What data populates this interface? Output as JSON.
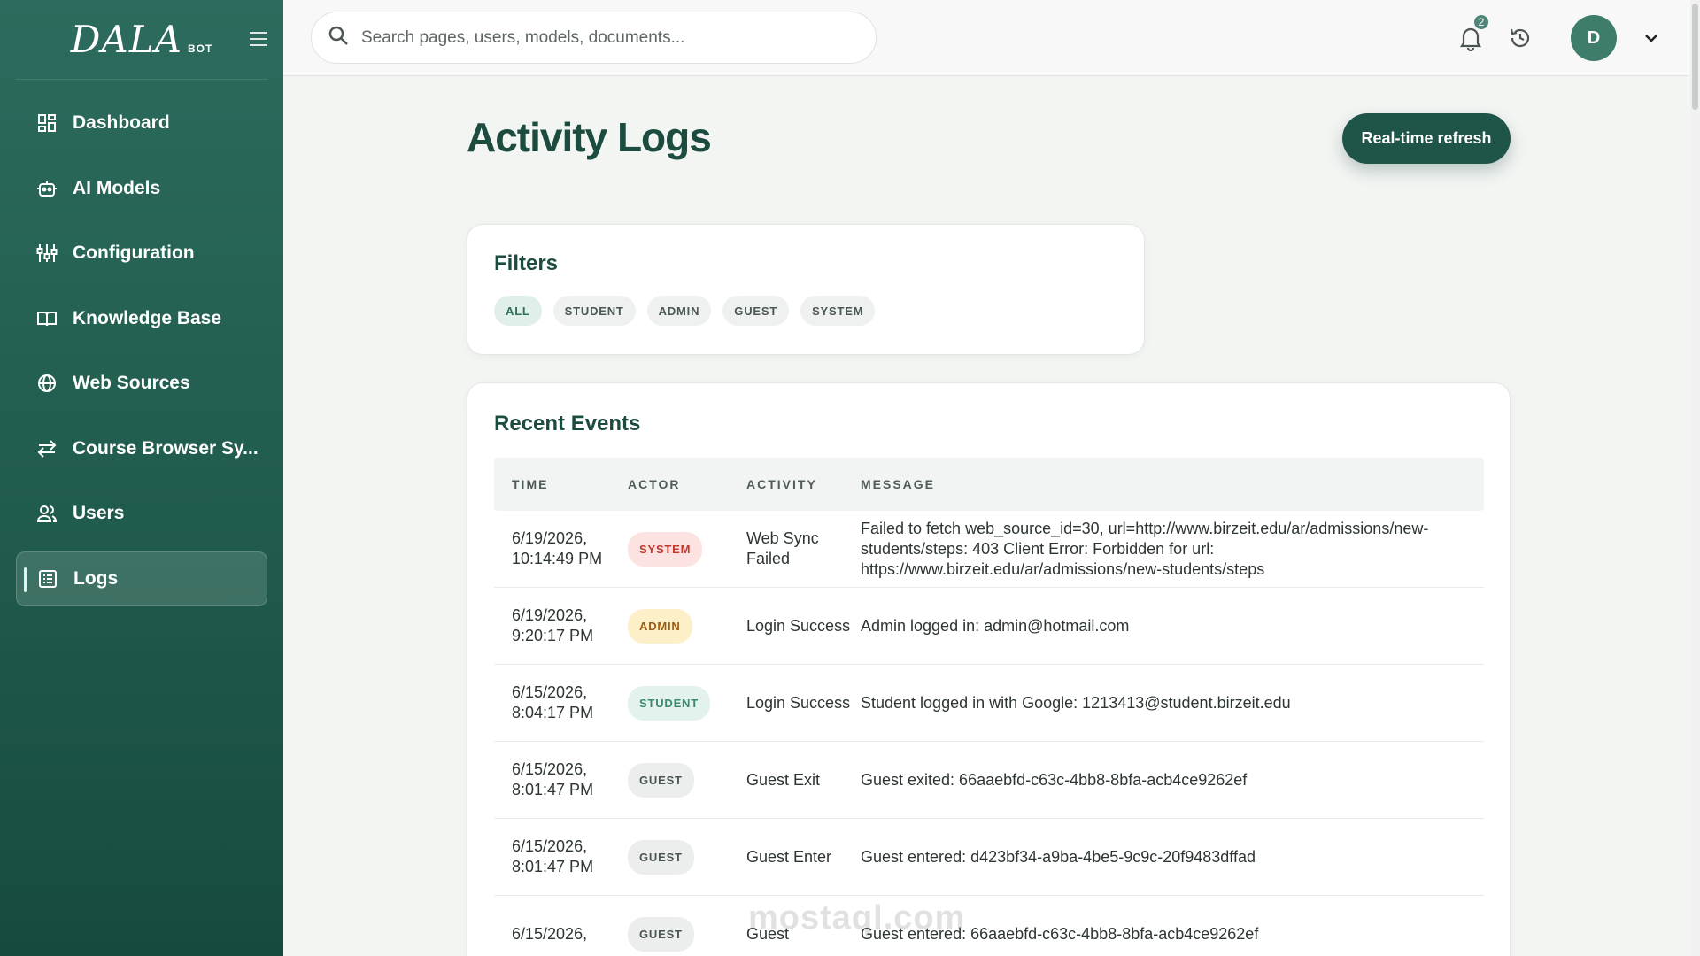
{
  "brand": {
    "name": "DALA",
    "sub": "BOT"
  },
  "sidebar": {
    "items": [
      {
        "label": "Dashboard",
        "icon": "dashboard-icon"
      },
      {
        "label": "AI Models",
        "icon": "robot-icon"
      },
      {
        "label": "Configuration",
        "icon": "sliders-icon"
      },
      {
        "label": "Knowledge Base",
        "icon": "book-icon"
      },
      {
        "label": "Web Sources",
        "icon": "globe-icon"
      },
      {
        "label": "Course Browser Sy...",
        "icon": "swap-icon"
      },
      {
        "label": "Users",
        "icon": "users-icon"
      },
      {
        "label": "Logs",
        "icon": "logs-icon",
        "active": true
      }
    ]
  },
  "topbar": {
    "search_placeholder": "Search pages, users, models, documents...",
    "notification_count": "2",
    "avatar_initial": "D"
  },
  "page": {
    "title": "Activity Logs",
    "refresh_label": "Real-time refresh"
  },
  "filters": {
    "title": "Filters",
    "chips": [
      "ALL",
      "STUDENT",
      "ADMIN",
      "GUEST",
      "SYSTEM"
    ],
    "active": "ALL"
  },
  "events": {
    "title": "Recent Events",
    "columns": [
      "TIME",
      "ACTOR",
      "ACTIVITY",
      "MESSAGE"
    ],
    "rows": [
      {
        "time": "6/19/2026, 10:14:49 PM",
        "actor": "SYSTEM",
        "activity": "Web Sync Failed",
        "message": "Failed to fetch web_source_id=30, url=http://www.birzeit.edu/ar/admissions/new-students/steps: 403 Client Error: Forbidden for url: https://www.birzeit.edu/ar/admissions/new-students/steps"
      },
      {
        "time": "6/19/2026, 9:20:17 PM",
        "actor": "ADMIN",
        "activity": "Login Success",
        "message": "Admin logged in: admin@hotmail.com"
      },
      {
        "time": "6/15/2026, 8:04:17 PM",
        "actor": "STUDENT",
        "activity": "Login Success",
        "message": "Student logged in with Google: 1213413@student.birzeit.edu"
      },
      {
        "time": "6/15/2026, 8:01:47 PM",
        "actor": "GUEST",
        "activity": "Guest Exit",
        "message": "Guest exited: 66aaebfd-c63c-4bb8-8bfa-acb4ce9262ef"
      },
      {
        "time": "6/15/2026, 8:01:47 PM",
        "actor": "GUEST",
        "activity": "Guest Enter",
        "message": "Guest entered: d423bf34-a9ba-4be5-9c9c-20f9483dffad"
      },
      {
        "time": "6/15/2026,",
        "actor": "GUEST",
        "activity": "Guest",
        "message": "Guest entered: 66aaebfd-c63c-4bb8-8bfa-acb4ce9262ef"
      }
    ]
  },
  "watermark": {
    "text": "mostaql.com"
  },
  "colors": {
    "sidebar": "#1f5a4c",
    "accent": "#1f5449",
    "title": "#1c4b40"
  }
}
